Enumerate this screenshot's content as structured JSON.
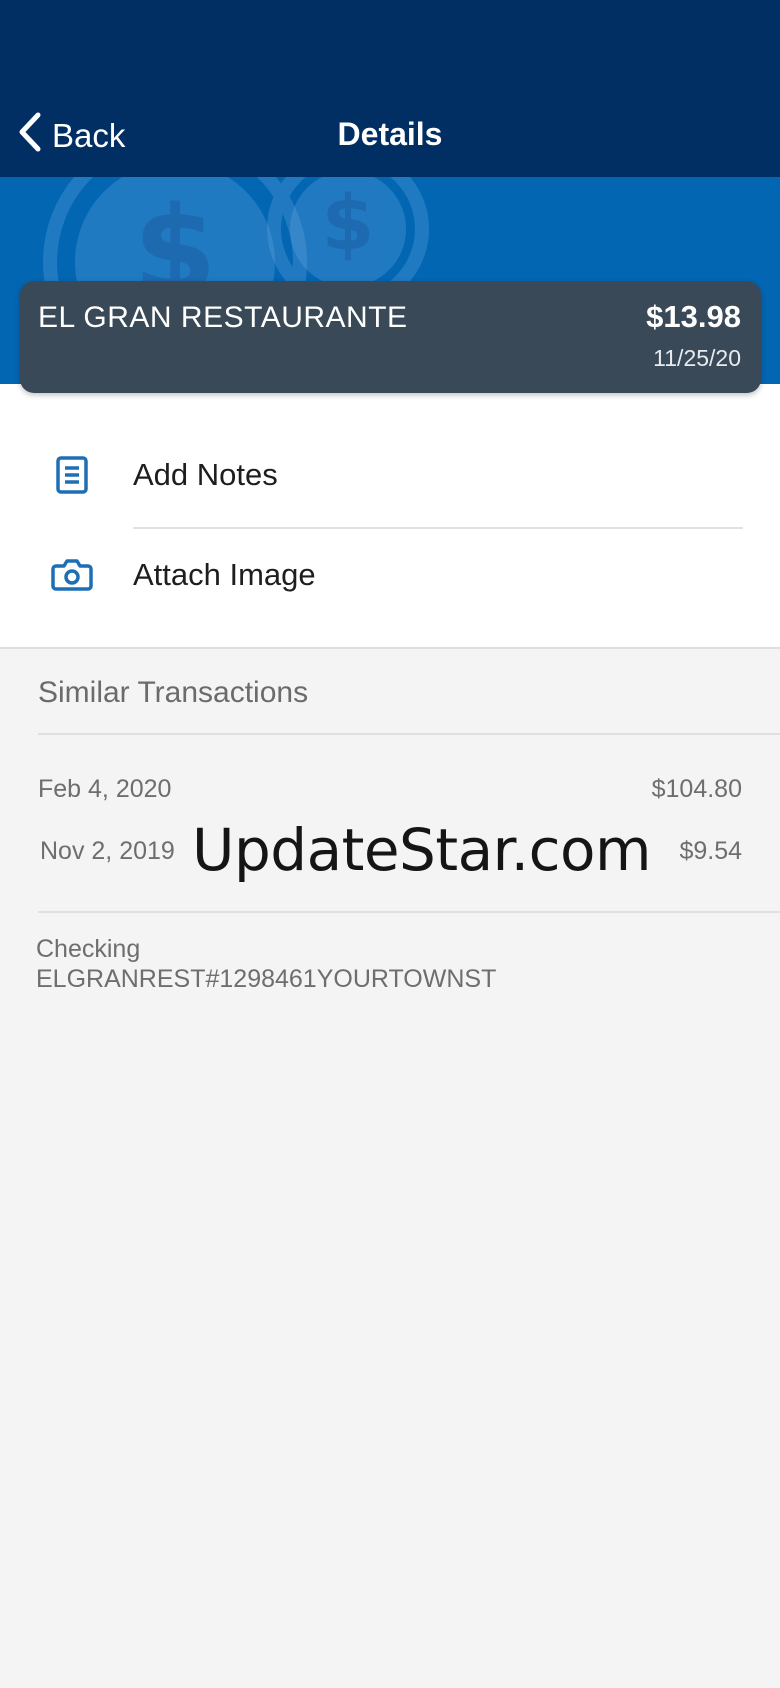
{
  "navbar": {
    "back_label": "Back",
    "title": "Details"
  },
  "colors": {
    "navbar_bg": "#022f63",
    "banner_bg": "#0366b3",
    "card_bg": "#3a4957",
    "icon_accent": "#1d6fb5"
  },
  "transaction": {
    "merchant": "EL GRAN RESTAURANTE",
    "amount": "$13.98",
    "date": "11/25/20"
  },
  "actions": [
    {
      "label": "Add Notes",
      "icon": "notes-icon"
    },
    {
      "label": "Attach Image",
      "icon": "camera-icon"
    }
  ],
  "similar": {
    "title": "Similar Transactions",
    "items": [
      {
        "date": "Feb 4, 2020",
        "amount": "$104.80"
      },
      {
        "date": "Nov 2, 2019",
        "amount": "$9.54"
      }
    ]
  },
  "watermark": "UpdateStar.com",
  "account": {
    "type": "Checking",
    "description": "ELGRANREST#1298461YOURTOWNST"
  }
}
